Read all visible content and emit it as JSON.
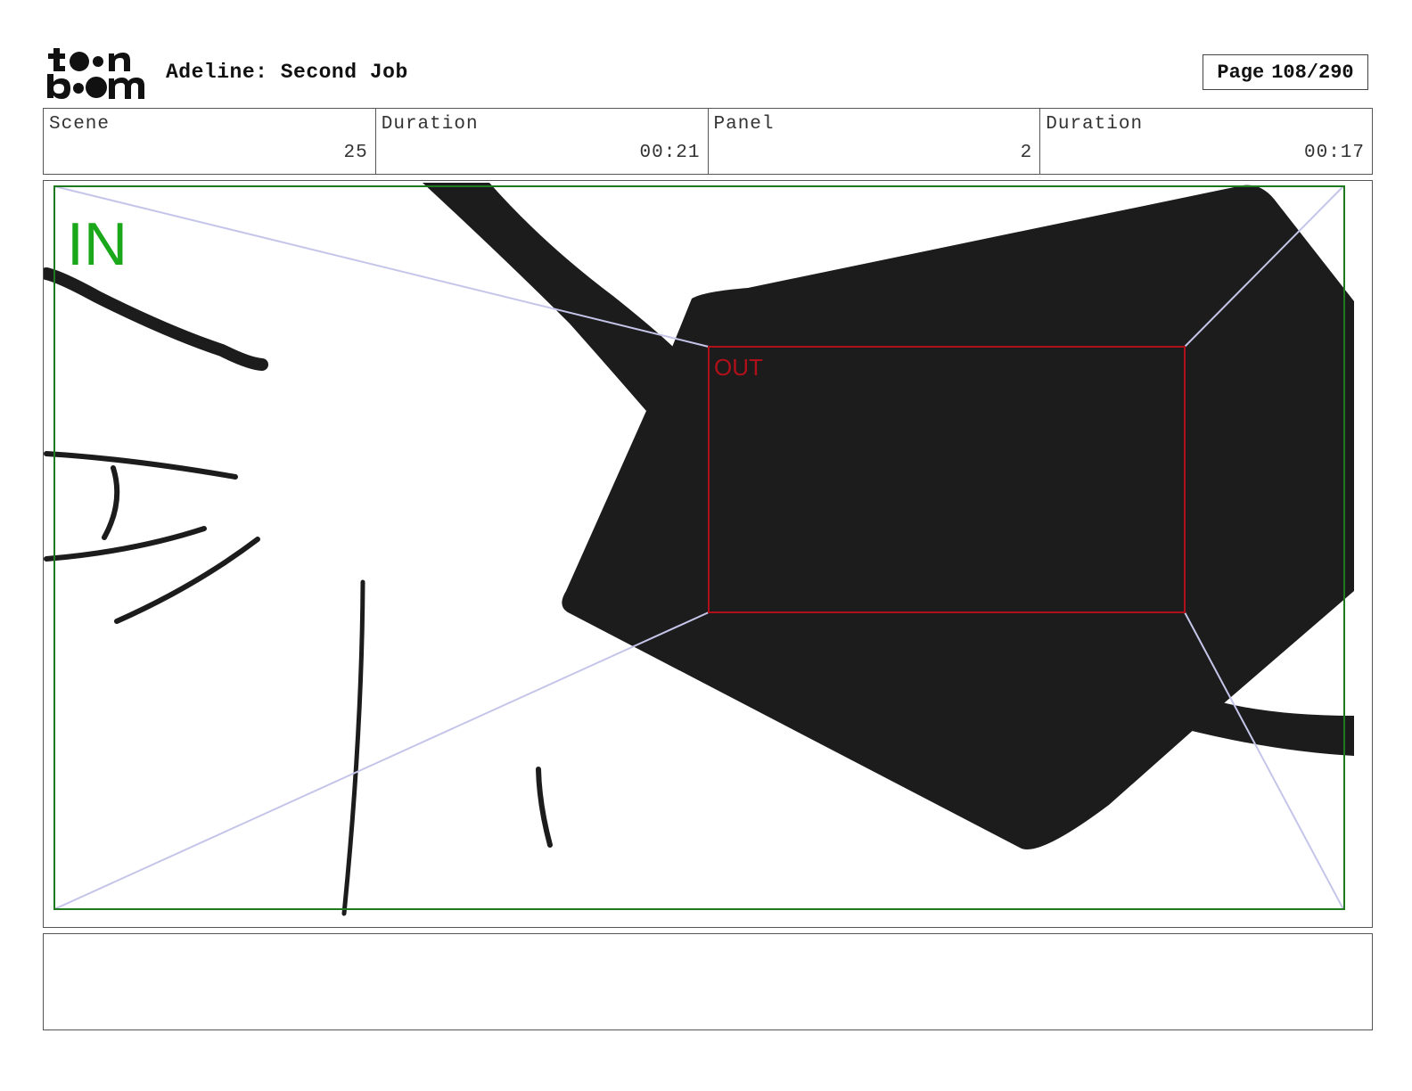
{
  "header": {
    "logo_text_top": "toon",
    "logo_text_bottom": "boom",
    "project_title": "Adeline: Second Job",
    "page_label": "Page",
    "page_value": "108/290"
  },
  "info": {
    "scene_label": "Scene",
    "scene_value": "25",
    "scene_duration_label": "Duration",
    "scene_duration_value": "00:21",
    "panel_label": "Panel",
    "panel_value": "2",
    "panel_duration_label": "Duration",
    "panel_duration_value": "00:17"
  },
  "panel": {
    "in_label": "IN",
    "out_label": "OUT",
    "colors": {
      "in_frame": "#1f7a1f",
      "in_text": "#1aa81a",
      "out_frame": "#b0101a",
      "guide_lines": "#c5c5ea",
      "ink": "#1c1c1c"
    }
  },
  "notes": {
    "text": ""
  }
}
